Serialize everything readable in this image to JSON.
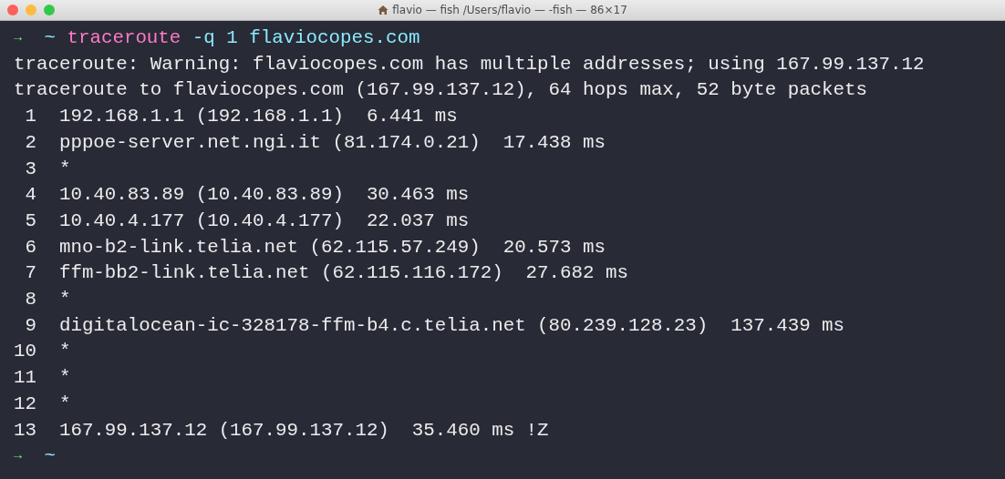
{
  "window": {
    "title": "flavio — fish /Users/flavio — -fish — 86×17"
  },
  "lines": [
    {
      "kind": "prompt",
      "symbol": "→",
      "cwd": "~",
      "command": "traceroute",
      "args": "-q 1 flaviocopes.com"
    },
    {
      "kind": "output",
      "text": "traceroute: Warning: flaviocopes.com has multiple addresses; using 167.99.137.12"
    },
    {
      "kind": "output",
      "text": "traceroute to flaviocopes.com (167.99.137.12), 64 hops max, 52 byte packets"
    },
    {
      "kind": "output",
      "text": " 1  192.168.1.1 (192.168.1.1)  6.441 ms"
    },
    {
      "kind": "output",
      "text": " 2  pppoe-server.net.ngi.it (81.174.0.21)  17.438 ms"
    },
    {
      "kind": "output",
      "text": " 3  *"
    },
    {
      "kind": "output",
      "text": " 4  10.40.83.89 (10.40.83.89)  30.463 ms"
    },
    {
      "kind": "output",
      "text": " 5  10.40.4.177 (10.40.4.177)  22.037 ms"
    },
    {
      "kind": "output",
      "text": " 6  mno-b2-link.telia.net (62.115.57.249)  20.573 ms"
    },
    {
      "kind": "output",
      "text": " 7  ffm-bb2-link.telia.net (62.115.116.172)  27.682 ms"
    },
    {
      "kind": "output",
      "text": " 8  *"
    },
    {
      "kind": "output",
      "text": " 9  digitalocean-ic-328178-ffm-b4.c.telia.net (80.239.128.23)  137.439 ms"
    },
    {
      "kind": "output",
      "text": "10  *"
    },
    {
      "kind": "output",
      "text": "11  *"
    },
    {
      "kind": "output",
      "text": "12  *"
    },
    {
      "kind": "output",
      "text": "13  167.99.137.12 (167.99.137.12)  35.460 ms !Z"
    },
    {
      "kind": "prompt",
      "symbol": "→",
      "cwd": "~"
    }
  ]
}
